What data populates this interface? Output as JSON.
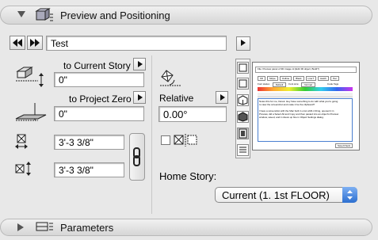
{
  "panel": {
    "title": "Preview and Positioning"
  },
  "toolbar": {
    "prev_icon": "rewind-icon",
    "next_icon": "fast-forward-icon",
    "name_value": "Test"
  },
  "left": {
    "current_story_label": "to Current Story",
    "current_story_value": "0\"",
    "project_zero_label": "to Project Zero",
    "project_zero_value": "0\"",
    "width_value": "3'-3 3/8\"",
    "height_value": "3'-3 3/8\""
  },
  "middle": {
    "relative_label": "Relative",
    "angle_value": "0.00°",
    "home_story_label": "Home Story:",
    "home_story_selected": "Current (1. 1st FLOOR)"
  },
  "preview": {
    "heading": "File: Preview panel of 3D image.ml  (Edit 3D object, Build?)",
    "nav_buttons": [
      "Fill",
      "Stripe",
      "Outline",
      "Black",
      "LineT",
      "Hatch",
      "Pen"
    ],
    "status_label": "Font status:",
    "status_value": "Default",
    "size_label": "Font size:",
    "size_value": "Normal",
    "code_tags": "Code Tags",
    "body_lines": [
      "Notes this for me, Derek. Hey have something to do with what you're going",
      "to view the screenshot and make it be the clipboard?",
      "",
      "I have a screenshot with the Mac built in omni-shift-4 thing, opened it in",
      "Preview, did a Select All and Copy and then pasted into an object's Preview",
      "window, saved, and it shows up fine in Object Settings dialog."
    ],
    "submit_label": "Save/Check"
  },
  "bottom": {
    "title": "Parameters"
  },
  "colors": {
    "accent": "#2d6fd0",
    "panel_bg": "#e8e8e8",
    "select_blue": "#5a8fe0"
  }
}
